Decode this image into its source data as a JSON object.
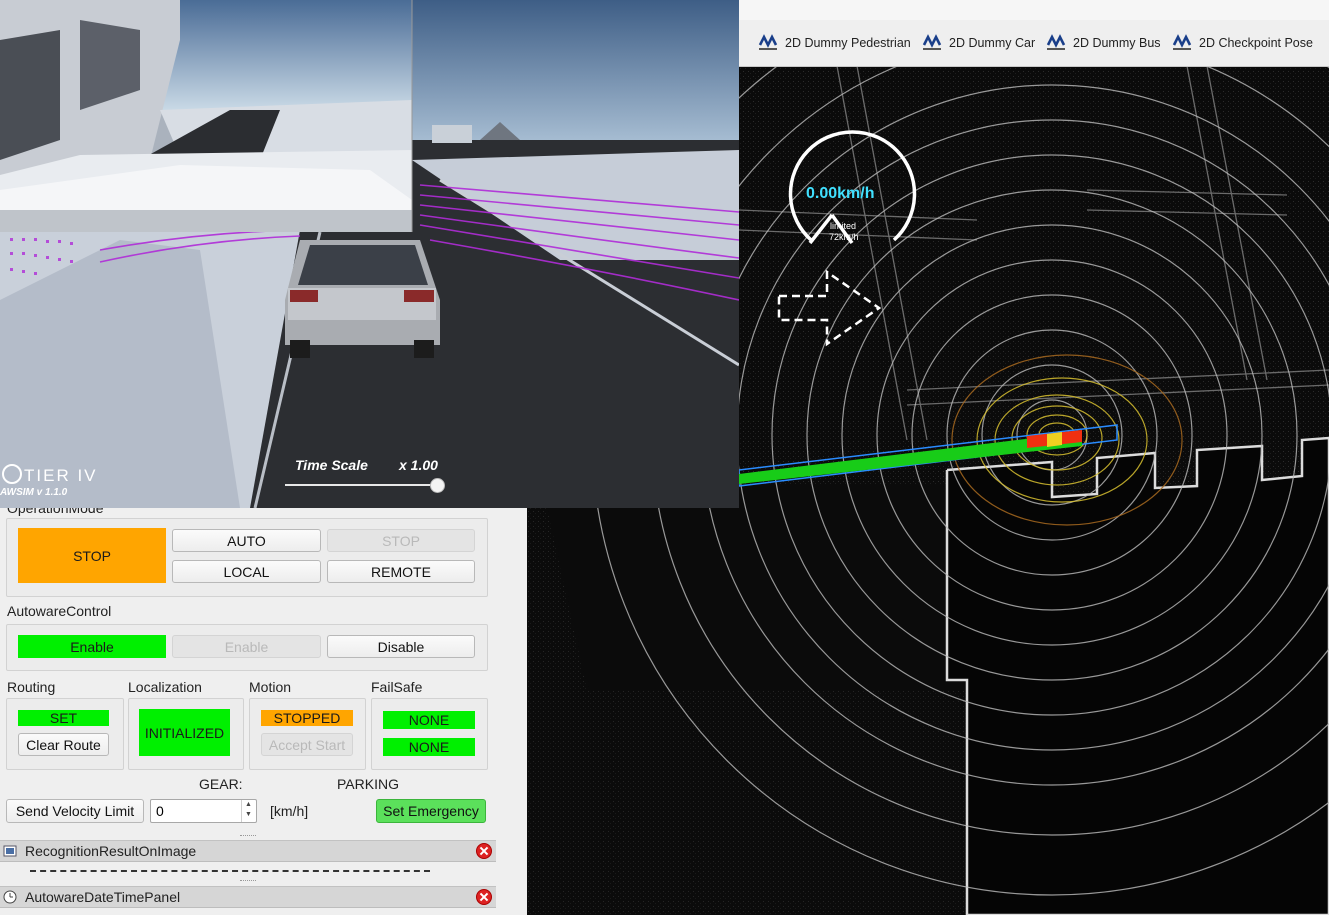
{
  "toolbar": {
    "tools": [
      {
        "label": "2D Dummy Pedestrian",
        "icon": "autoware-icon"
      },
      {
        "label": "2D Dummy Car",
        "icon": "autoware-icon"
      },
      {
        "label": "2D Dummy Bus",
        "icon": "autoware-icon"
      },
      {
        "label": "2D Checkpoint Pose",
        "icon": "autoware-icon"
      }
    ]
  },
  "viewport": {
    "speed": "0.00km/h",
    "limit_line1": "limited",
    "limit_line2": "72km/h",
    "turn_signal": "right"
  },
  "simulator": {
    "time_scale_label": "Time Scale",
    "time_scale_value": "x 1.00",
    "time_scale_level": 1.0,
    "logo_text": "TIER IV",
    "version_text": "AWSIM  v 1.1.0"
  },
  "panel": {
    "operation_mode": {
      "title": "OperationMode",
      "state": "STOP",
      "auto": "AUTO",
      "stop": "STOP",
      "local": "LOCAL",
      "remote": "REMOTE"
    },
    "autoware_control": {
      "title": "AutowareControl",
      "state": "Enable",
      "enable": "Enable",
      "disable": "Disable"
    },
    "routing": {
      "title": "Routing",
      "state": "SET",
      "clear": "Clear Route"
    },
    "localization": {
      "title": "Localization",
      "state": "INITIALIZED"
    },
    "motion": {
      "title": "Motion",
      "state": "STOPPED",
      "accept": "Accept Start"
    },
    "failsafe": {
      "title": "FailSafe",
      "state1": "NONE",
      "state2": "NONE"
    },
    "gear_label": "GEAR:",
    "parking_label": "PARKING",
    "send_velocity": "Send Velocity Limit",
    "velocity_value": "0",
    "unit": "[km/h]",
    "set_emergency": "Set Emergency",
    "docks": [
      {
        "title": "RecognitionResultOnImage"
      },
      {
        "title": "AutowareDateTimePanel"
      }
    ]
  },
  "colors": {
    "green": "#00f000",
    "orange": "#ffa500",
    "path": "#22dd22",
    "speed_text": "#40e0ff"
  }
}
